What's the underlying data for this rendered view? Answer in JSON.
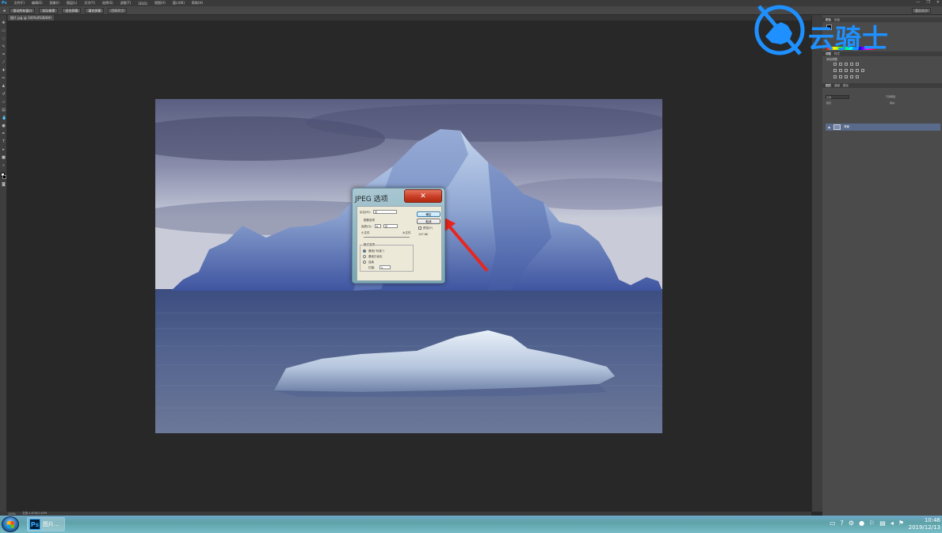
{
  "app": {
    "logo": "Ps",
    "menu": [
      "文件(F)",
      "编辑(E)",
      "图像(I)",
      "图层(L)",
      "文字(Y)",
      "选择(S)",
      "滤镜(T)",
      "3D(D)",
      "视图(V)",
      "窗口(W)",
      "帮助(H)"
    ],
    "window_controls": [
      "—",
      "❐",
      "✕"
    ]
  },
  "options_bar": {
    "buttons": [
      "滚动所有窗口",
      "实际像素",
      "适合屏幕",
      "填充屏幕",
      "打印尺寸"
    ],
    "workspace": "显示大小"
  },
  "document": {
    "tab_label": "图片.jpg @ 100%(RGB/8#)",
    "status_zoom": "100%",
    "status_doc": "文档:1.67M/1.67M"
  },
  "right_panel": {
    "color_tabs": [
      "颜色",
      "色板"
    ],
    "adjust_tabs": [
      "调整",
      "样式"
    ],
    "adjust_title": "添加调整",
    "layer_tabs": [
      "图层",
      "通道",
      "路径"
    ],
    "blend_mode": "正常",
    "opacity_label": "不透明度:",
    "fill_label": "填充:",
    "lock_label": "锁定:",
    "layer_name": "背景"
  },
  "dialog": {
    "title": "JPEG 选项",
    "close": "✕",
    "matte_label": "杂边(M):",
    "matte_value": "无",
    "image_options_label": "图像选项",
    "quality_label": "品质(Q):",
    "quality_value": "8",
    "quality_select": "高",
    "small_file": "小文件",
    "large_file": "大文件",
    "format_options_label": "格式选项",
    "formats": [
      "基线(\"标准\")",
      "基线已优化",
      "连续"
    ],
    "scans_label": "扫描:",
    "scans_value": "3",
    "ok": "确定",
    "cancel": "取消",
    "preview_label": "预览(P)",
    "size_label": "147.8K"
  },
  "taskbar": {
    "task_label": "图片...",
    "time": "10:46",
    "date": "2019/12/13"
  },
  "watermark": {
    "text": "云骑士"
  },
  "colors": {
    "accent": "#31a8ff",
    "dialog_close": "#c63a22",
    "arrow": "#e8261d",
    "watermark": "#1e90ff"
  }
}
